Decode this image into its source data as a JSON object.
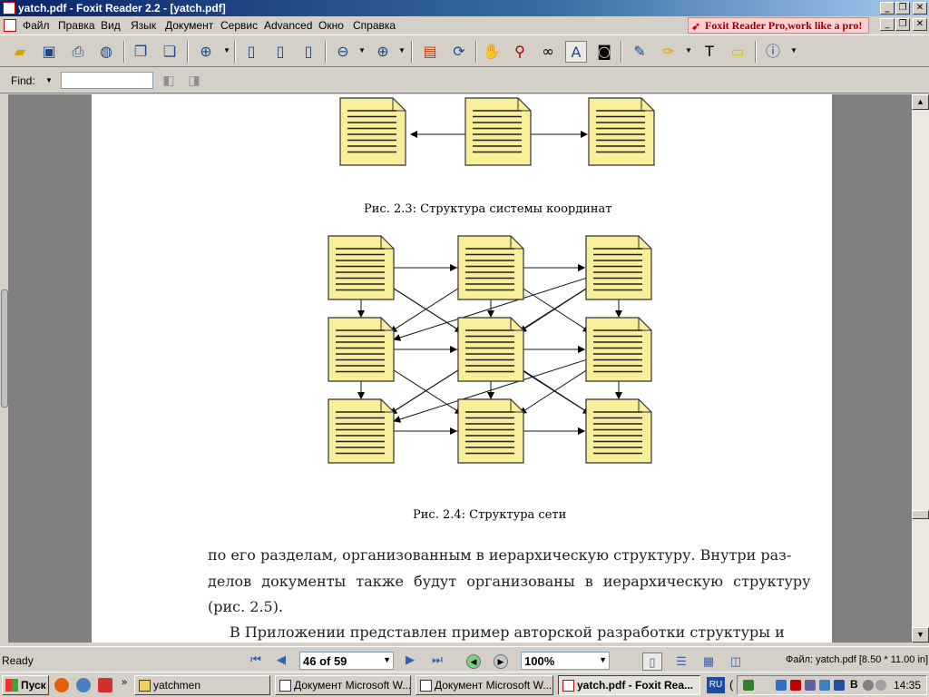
{
  "window": {
    "title": "yatch.pdf - Foxit Reader 2.2 - [yatch.pdf]",
    "min": "_",
    "restore": "❐",
    "close": "✕"
  },
  "menu": {
    "items": [
      "Файл",
      "Правка",
      "Вид",
      "Язык",
      "Документ",
      "Сервис",
      "Advanced",
      "Окно",
      "Справка"
    ],
    "promo": "Foxit Reader Pro,work like a pro!"
  },
  "toolbar": {
    "icons": [
      "open-icon",
      "save-icon",
      "print-icon",
      "email-icon",
      "copy-icon",
      "paste-icon",
      "zoom-icon",
      "page-icon",
      "page-width-icon",
      "page-fit-icon",
      "zoom-out-icon",
      "zoom-in-icon",
      "bookmark-icon",
      "rotate-icon",
      "hand-icon",
      "select-icon",
      "binoculars-icon",
      "text-select-icon",
      "snapshot-icon",
      "annotate-icon",
      "highlight-icon",
      "typewriter-icon",
      "note-icon",
      "info-icon"
    ]
  },
  "find": {
    "label": "Find:",
    "value": ""
  },
  "document": {
    "caption_top": "Рис. 2.3: Структура системы координат",
    "caption_bottom": "Рис. 2.4: Структура сети",
    "paragraph_lines": [
      "по его разделам, организованным в иерархическую структуру. Внутри раз-",
      "делов документы также будут организованы в иерархическую структуру",
      "(рис. 2.5).",
      "В Приложении представлен пример авторской разработки структуры и"
    ],
    "doc_fill": "#f7ef9a",
    "doc_stroke": "#333333"
  },
  "status": {
    "ready": "Ready",
    "page": "46 of 59",
    "zoom": "100%",
    "file_info": "Файл: yatch.pdf [8.50 * 11.00 in]"
  },
  "taskbar": {
    "start": "Пуск",
    "tasks": [
      {
        "label": "yatchmen",
        "active": false
      },
      {
        "label": "Документ Microsoft W...",
        "active": false
      },
      {
        "label": "Документ Microsoft W...",
        "active": false
      },
      {
        "label": "yatch.pdf - Foxit Rea...",
        "active": true
      }
    ],
    "lang": "RU",
    "tray_letter": "B",
    "clock": "14:35"
  }
}
